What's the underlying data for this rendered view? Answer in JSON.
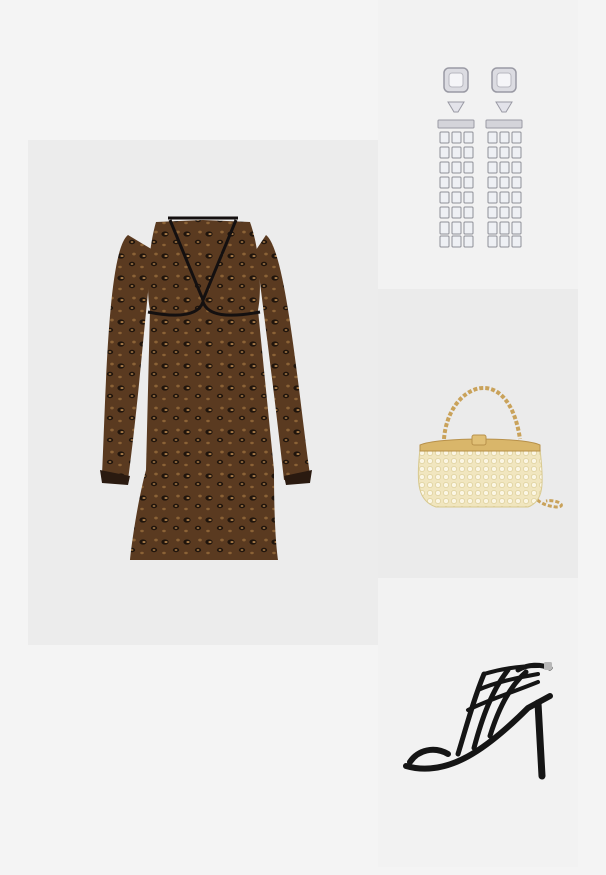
{
  "page": {
    "background": "#f4f4f4"
  },
  "products": [
    {
      "name": "dress",
      "icon": "leopard-print-dress",
      "colors": {
        "base": "#5a3a20",
        "spot": "#1f140c",
        "light": "#a57845"
      }
    },
    {
      "name": "earrings",
      "icon": "crystal-drop-earrings",
      "colors": {
        "metal": "#c9c9cf",
        "gem": "#e9e9ef"
      }
    },
    {
      "name": "handbag",
      "icon": "pearl-clutch-bag",
      "colors": {
        "body": "#f1e6bf",
        "pearl": "#fbf6e4",
        "chain": "#c9a25a"
      }
    },
    {
      "name": "heels",
      "icon": "strappy-heel-sandal",
      "colors": {
        "leather": "#151515"
      }
    }
  ]
}
